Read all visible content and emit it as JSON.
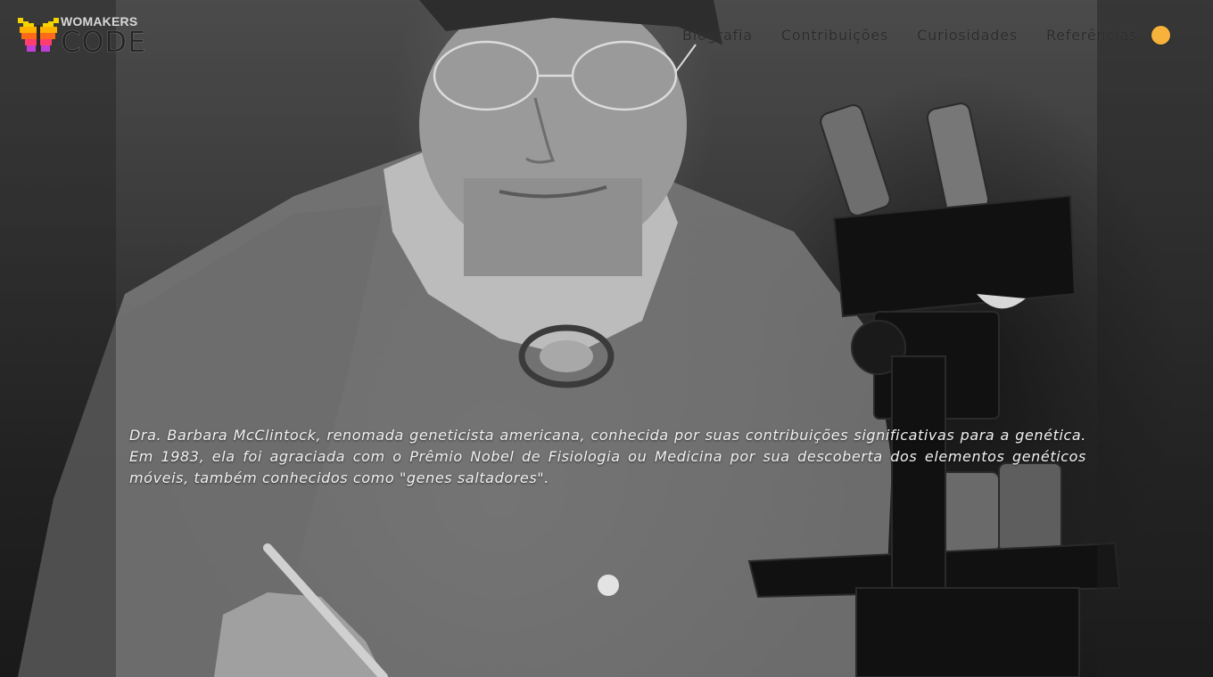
{
  "logo": {
    "top_text": "WOMAKERS",
    "bottom_text": "CODE",
    "icon": "butterfly-logo-icon",
    "colors": [
      "#f5d400",
      "#ff8a00",
      "#ff3d6e",
      "#c13fd9"
    ]
  },
  "nav": {
    "items": [
      {
        "label": "Biografia"
      },
      {
        "label": "Contribuições"
      },
      {
        "label": "Curiosidades"
      },
      {
        "label": "Referências"
      }
    ],
    "theme_toggle": {
      "icon": "theme-toggle-icon",
      "color": "#f7b23b"
    }
  },
  "hero": {
    "image": "black-and-white photo of scientist at microscope",
    "bio_text": "Dra. Barbara McClintock, renomada geneticista americana, conhecida por suas contribuições significativas para a genética. Em 1983, ela foi agraciada com o Prêmio Nobel de Fisiologia ou Medicina por sua descoberta dos elementos genéticos móveis, também conhecidos como \"genes saltadores\"."
  }
}
